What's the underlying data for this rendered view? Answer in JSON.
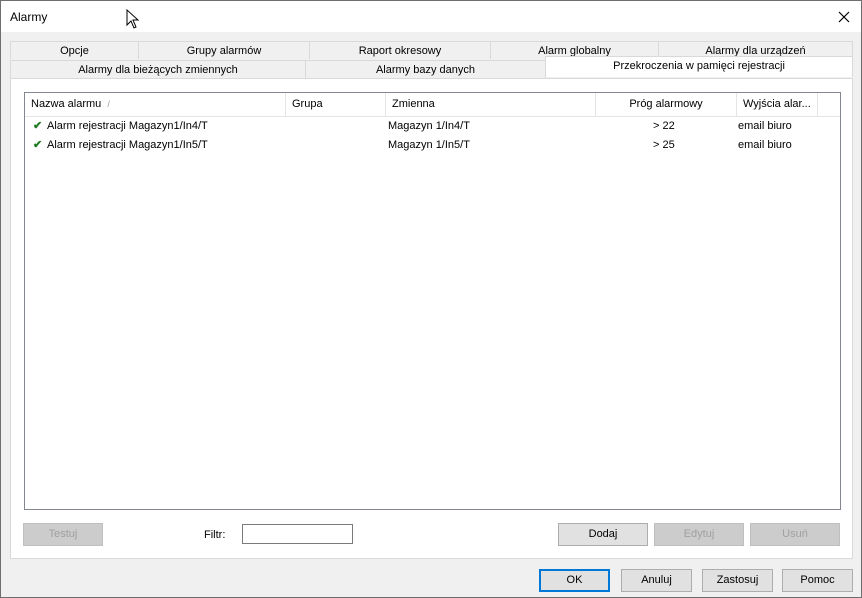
{
  "window": {
    "title": "Alarmy"
  },
  "tabs": {
    "row1": [
      "Opcje",
      "Grupy alarmów",
      "Raport okresowy",
      "Alarm globalny",
      "Alarmy dla urządzeń"
    ],
    "row2": [
      "Alarmy dla bieżących zmiennych",
      "Alarmy bazy danych",
      "Przekroczenia w pamięci rejestracji"
    ],
    "active": "Przekroczenia w pamięci rejestracji"
  },
  "list": {
    "columns": [
      "Nazwa alarmu",
      "Grupa",
      "Zmienna",
      "Próg alarmowy",
      "Wyjścia alar..."
    ],
    "rows": [
      {
        "name": "Alarm rejestracji Magazyn1/In4/T",
        "group": "",
        "variable": "Magazyn 1/In4/T",
        "threshold": "> 22",
        "outputs": "email biuro"
      },
      {
        "name": "Alarm rejestracji Magazyn1/In5/T",
        "group": "",
        "variable": "Magazyn 1/In5/T",
        "threshold": "> 25",
        "outputs": "email biuro"
      }
    ]
  },
  "controls": {
    "test_label": "Testuj",
    "filter_label": "Filtr:",
    "filter_value": "",
    "add_label": "Dodaj",
    "edit_label": "Edytuj",
    "delete_label": "Usuń"
  },
  "footer": {
    "ok_label": "OK",
    "cancel_label": "Anuluj",
    "apply_label": "Zastosuj",
    "help_label": "Pomoc"
  },
  "icons": {
    "check": "✔",
    "close": "close-icon",
    "cursor": "cursor-icon"
  },
  "colors": {
    "accent": "#0078d7",
    "check": "#1e7b22"
  }
}
